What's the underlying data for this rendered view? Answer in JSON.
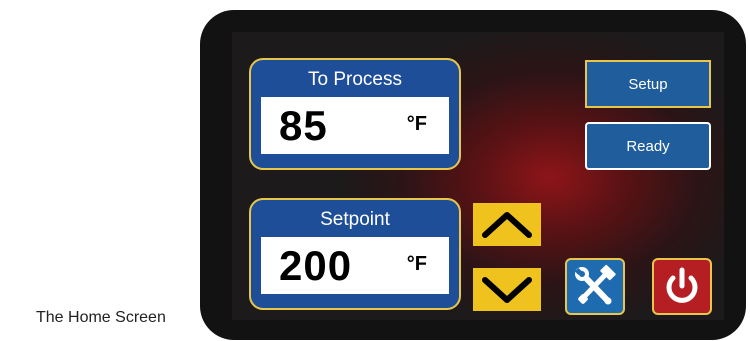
{
  "caption": "The Home Screen",
  "process": {
    "title": "To Process",
    "value": "85",
    "unit": "°F"
  },
  "setpoint": {
    "title": "Setpoint",
    "value": "200",
    "unit": "°F"
  },
  "buttons": {
    "setup_label": "Setup",
    "ready_label": "Ready"
  },
  "icons": {
    "up": "chevron-up-icon",
    "down": "chevron-down-icon",
    "tools": "tools-icon",
    "power": "power-icon"
  },
  "colors": {
    "panel_blue": "#1f4e99",
    "border_gold": "#e8c64a",
    "arrow_yellow": "#f0c21e",
    "power_red": "#b51f24",
    "screen_glow": "#8e1519"
  }
}
